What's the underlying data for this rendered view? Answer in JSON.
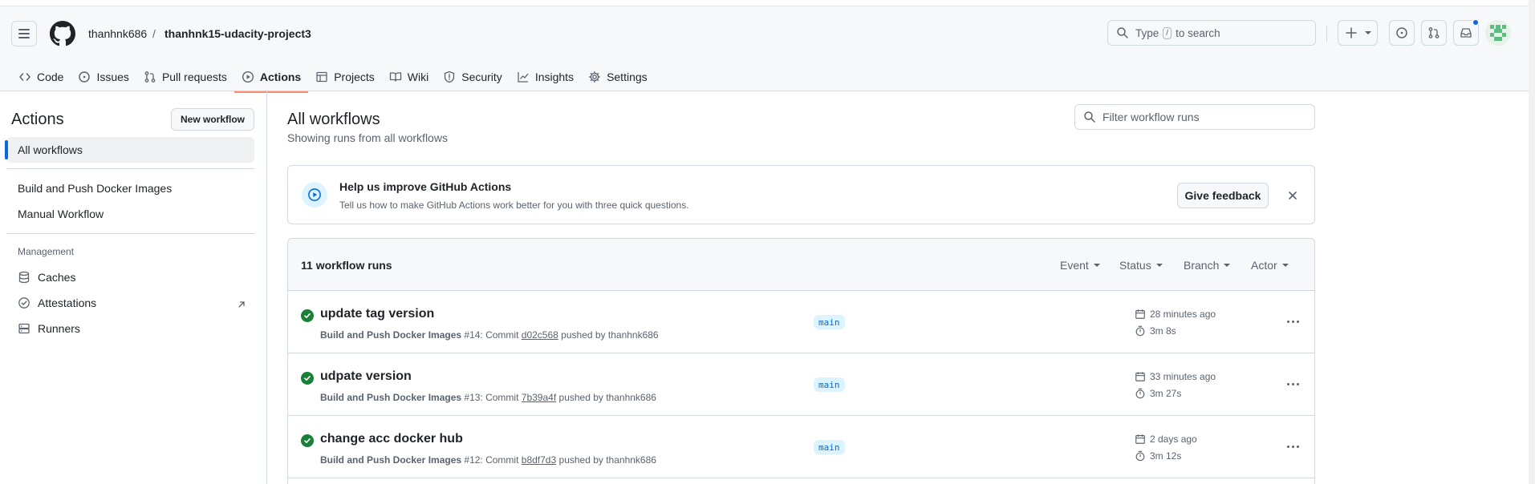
{
  "header": {
    "owner": "thanhnk686",
    "separator": "/",
    "repo": "thanhnk15-udacity-project3",
    "search_before": "Type",
    "search_key": "/",
    "search_after": "to search"
  },
  "tabs": [
    {
      "label": "Code",
      "icon": "code-icon"
    },
    {
      "label": "Issues",
      "icon": "issue-icon"
    },
    {
      "label": "Pull requests",
      "icon": "pull-request-icon"
    },
    {
      "label": "Actions",
      "icon": "play-icon",
      "active": true
    },
    {
      "label": "Projects",
      "icon": "table-icon"
    },
    {
      "label": "Wiki",
      "icon": "book-icon"
    },
    {
      "label": "Security",
      "icon": "shield-icon"
    },
    {
      "label": "Insights",
      "icon": "graph-icon"
    },
    {
      "label": "Settings",
      "icon": "gear-icon"
    }
  ],
  "sidebar": {
    "title": "Actions",
    "new_workflow": "New workflow",
    "all_workflows": "All workflows",
    "workflows": [
      "Build and Push Docker Images",
      "Manual Workflow"
    ],
    "management_label": "Management",
    "management": [
      {
        "label": "Caches",
        "icon": "database-icon"
      },
      {
        "label": "Attestations",
        "icon": "verified-icon"
      },
      {
        "label": "Runners",
        "icon": "server-icon"
      }
    ]
  },
  "main": {
    "title": "All workflows",
    "subtitle": "Showing runs from all workflows",
    "filter_placeholder": "Filter workflow runs"
  },
  "feedback": {
    "title": "Help us improve GitHub Actions",
    "description": "Tell us how to make GitHub Actions work better for you with three quick questions.",
    "button": "Give feedback"
  },
  "runs": {
    "count_label": "11 workflow runs",
    "filters": [
      "Event",
      "Status",
      "Branch",
      "Actor"
    ],
    "items": [
      {
        "title": "update tag version",
        "workflow": "Build and Push Docker Images",
        "run_number": "#14",
        "commit_label": "Commit",
        "sha": "d02c568",
        "pushed_by": "pushed by thanhnk686",
        "branch": "main",
        "time": "28 minutes ago",
        "duration": "3m 8s",
        "status": "success"
      },
      {
        "title": "udpate version",
        "workflow": "Build and Push Docker Images",
        "run_number": "#13",
        "commit_label": "Commit",
        "sha": "7b39a4f",
        "pushed_by": "pushed by thanhnk686",
        "branch": "main",
        "time": "33 minutes ago",
        "duration": "3m 27s",
        "status": "success"
      },
      {
        "title": "change acc docker hub",
        "workflow": "Build and Push Docker Images",
        "run_number": "#12",
        "commit_label": "Commit",
        "sha": "b8df7d3",
        "pushed_by": "pushed by thanhnk686",
        "branch": "main",
        "time": "2 days ago",
        "duration": "3m 12s",
        "status": "success"
      }
    ]
  },
  "colors": {
    "accent": "#0969da",
    "success": "#1a7f37",
    "tab_underline": "#fd8c73"
  }
}
